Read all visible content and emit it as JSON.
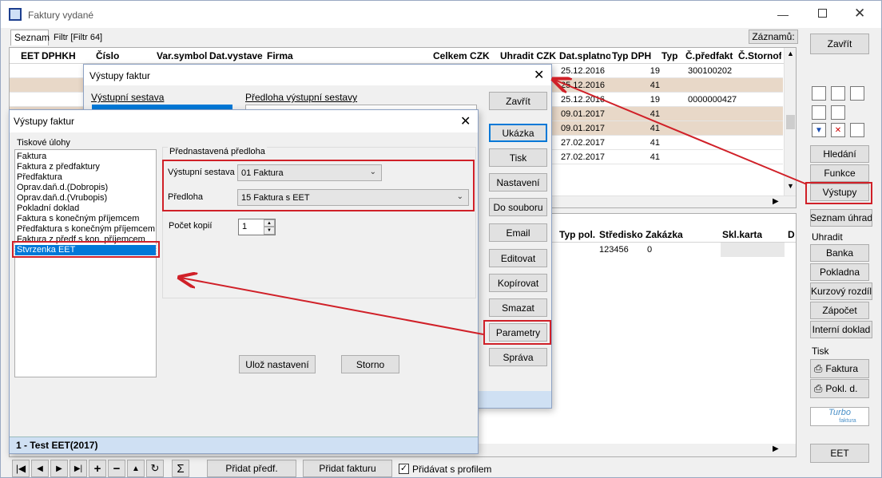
{
  "main_window": {
    "title": "Faktury vydané",
    "tabs": [
      "Seznam",
      "Filtr [Filtr 64]"
    ],
    "zaznamu_label": "Záznamů:",
    "columns": [
      "EET",
      "DPHKH",
      "Číslo",
      "Var.symbol",
      "Dat.vystave",
      "Firma",
      "Celkem CZK",
      "Uhradit CZK",
      "Dat.splatno",
      "Typ DPH",
      "Typ",
      "Č.předfakt",
      "Č.Stornof"
    ],
    "rows": [
      {
        "splatno": "25.12.2016",
        "typdph": "19",
        "predfakt": "300100202",
        "highlight": false
      },
      {
        "splatno": "25.12.2016",
        "typdph": "41",
        "predfakt": "",
        "highlight": true
      },
      {
        "splatno": "25.12.2016",
        "typdph": "19",
        "predfakt": "0000000427",
        "highlight": false
      },
      {
        "splatno": "09.01.2017",
        "typdph": "41",
        "predfakt": "",
        "highlight": true
      },
      {
        "splatno": "09.01.2017",
        "typdph": "41",
        "predfakt": "",
        "highlight": true
      },
      {
        "splatno": "27.02.2017",
        "typdph": "41",
        "predfakt": "",
        "highlight": false
      },
      {
        "splatno": "27.02.2017",
        "typdph": "41",
        "predfakt": "",
        "highlight": false
      }
    ],
    "lower_columns": [
      "Typ pol.",
      "Středisko",
      "Zakázka",
      "Skl.karta",
      "D"
    ],
    "lower_row": {
      "stredisko": "123456",
      "zakazka": "0"
    },
    "bottom": {
      "pridat_predf": "Přidat předf.",
      "pridat_fakturu": "Přidat fakturu",
      "pridavat_s_profilem": "Přidávat s profilem"
    }
  },
  "right_panel": {
    "zavrit": "Zavřít",
    "hledani": "Hledání",
    "funkce": "Funkce",
    "vystupy": "Výstupy",
    "seznam_uhrad": "Seznam úhrad",
    "uhradit_label": "Uhradit",
    "banka": "Banka",
    "pokladna": "Pokladna",
    "kurzovy_rozdil": "Kurzový rozdíl",
    "zapocet": "Zápočet",
    "interni_doklad": "Interní doklad",
    "tisk_label": "Tisk",
    "faktura": "Faktura",
    "pokl_d": "Pokl. d.",
    "turbo": "Turbo",
    "turbo_sub": "faktura",
    "eet": "EET"
  },
  "dialog_back": {
    "title": "Výstupy faktur",
    "vystupni_sestava_label": "Výstupní sestava",
    "predloha_label": "Předloha výstupní sestavy",
    "buttons": {
      "zavrit": "Zavřít",
      "ukazka": "Ukázka",
      "tisk": "Tisk",
      "nastaveni": "Nastavení",
      "do_souboru": "Do souboru",
      "email": "Email",
      "editovat": "Editovat",
      "kopirovat": "Kopírovat",
      "smazat": "Smazat",
      "parametry": "Parametry",
      "sprava": "Správa"
    }
  },
  "dialog_front": {
    "title": "Výstupy faktur",
    "tiskove_ulohy_label": "Tiskové úlohy",
    "ulohy": [
      "Faktura",
      "Faktura z předfaktury",
      "Předfaktura",
      "Oprav.daň.d.(Dobropis)",
      "Oprav.daň.d.(Vrubopis)",
      "Pokladní doklad",
      "Faktura s konečným příjemcem",
      "Předfaktura s konečným příjemcem",
      "Faktura z předf.s kon. příjemcem",
      "Stvrzenka EET"
    ],
    "selected_index": 9,
    "prednastavena_label": "Přednastavená předloha",
    "vystupni_sestava_label": "Výstupní sestava",
    "vystupni_sestava_value": "01 Faktura",
    "predloha_label": "Předloha",
    "predloha_value": "15 Faktura s EET",
    "pocet_kopii_label": "Počet kopií",
    "pocet_kopii_value": "1",
    "uloz_nastaveni": "Ulož nastavení",
    "storno": "Storno",
    "status": "1 - Test EET(2017)"
  },
  "colors": {
    "highlight_row": "#e8d8c8",
    "red_annotation": "#d02028",
    "selected_item": "#0078d7",
    "status_bar": "#cfe0f3"
  }
}
